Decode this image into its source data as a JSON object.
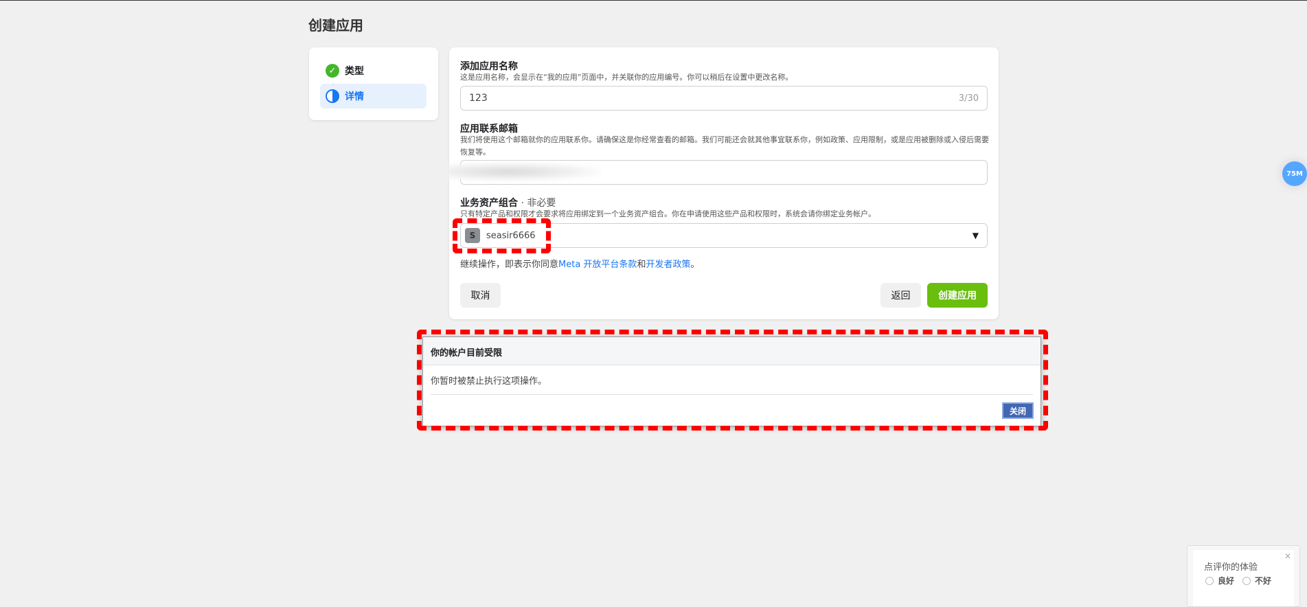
{
  "page_title": "创建应用",
  "steps": [
    {
      "label": "类型",
      "status": "done"
    },
    {
      "label": "详情",
      "status": "current"
    }
  ],
  "form": {
    "app_name": {
      "label": "添加应用名称",
      "desc": "这是应用名称，会显示在“我的应用”页面中，并关联你的应用编号。你可以稍后在设置中更改名称。",
      "value": "123",
      "counter": "3/30"
    },
    "email": {
      "label": "应用联系邮箱",
      "desc": "我们将使用这个邮箱就你的应用联系你。请确保这是你经常查看的邮箱。我们可能还会就其他事宜联系你，例如政策、应用限制，或是应用被删除或入侵后需要恢复等。",
      "value": ""
    },
    "portfolio": {
      "label": "业务资产组合",
      "optional": " · 非必要",
      "desc": "只有特定产品和权限才会要求将应用绑定到一个业务资产组合。你在申请使用这些产品和权限时，系统会请你绑定业务帐户。",
      "avatar_letter": "S",
      "value": "seasir6666"
    },
    "terms": {
      "prefix": "继续操作，即表示你同意",
      "link1": "Meta 开放平台条款",
      "mid": "和",
      "link2": "开发者政策",
      "suffix": "。"
    },
    "cancel": "取消",
    "back": "返回",
    "create": "创建应用"
  },
  "dialog": {
    "title": "你的帐户目前受限",
    "body": "你暂时被禁止执行这项操作。",
    "close": "关闭"
  },
  "badge": "75M",
  "feedback": {
    "title": "点评你的体验",
    "good": "良好",
    "bad": "不好",
    "close": "✕"
  },
  "colors": {
    "accent": "#1877f2",
    "create_green": "#69be0e",
    "highlight": "#e7f0fd",
    "dialog_btn": "#4267b2"
  }
}
